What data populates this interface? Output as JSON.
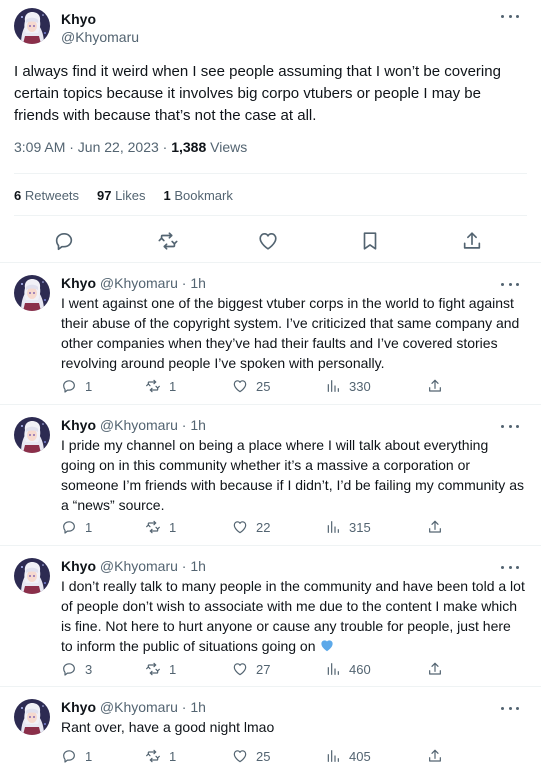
{
  "main_tweet": {
    "author": {
      "name": "Khyo",
      "handle": "@Khyomaru"
    },
    "text": "I always find it weird when I see people assuming that I won’t be covering certain topics because it involves big corpo vtubers or people I may be friends with because that’s not the case at all.",
    "timestamp": "3:09 AM · Jun 22, 2023 · ",
    "views_count": "1,388",
    "views_label": " Views",
    "stats": {
      "retweets_count": "6",
      "retweets_label": " Retweets",
      "likes_count": "97",
      "likes_label": " Likes",
      "bookmarks_count": "1",
      "bookmarks_label": " Bookmark"
    },
    "actions": [
      "reply-icon",
      "retweet-icon",
      "like-icon",
      "bookmark-icon",
      "share-icon"
    ]
  },
  "replies": [
    {
      "name": "Khyo",
      "handle": "@Khyomaru",
      "time": " · 1h",
      "text": "I went against one of the biggest vtuber corps in the world to fight against their abuse of the copyright system. I’ve criticized that same company and other companies when they’ve had their faults and I’ve covered stories revolving around people I’ve spoken with personally.",
      "replies": "1",
      "retweets": "1",
      "likes": "25",
      "views": "330"
    },
    {
      "name": "Khyo",
      "handle": "@Khyomaru",
      "time": " · 1h",
      "text": "I pride my channel on being a place where I will talk about everything going on in this community whether it’s a massive a corporation or someone I’m friends with because if I didn’t, I’d be failing my community as a “news” source.",
      "replies": "1",
      "retweets": "1",
      "likes": "22",
      "views": "315"
    },
    {
      "name": "Khyo",
      "handle": "@Khyomaru",
      "time": " · 1h",
      "text": "I don’t really talk to many people in the community and have been told a lot of people don’t wish to associate with me due to the content I make which is fine. Not here to hurt anyone or cause any trouble for people, just here to inform the public of situations going on",
      "emoji": "blue-heart-emoji",
      "replies": "3",
      "retweets": "1",
      "likes": "27",
      "views": "460"
    },
    {
      "name": "Khyo",
      "handle": "@Khyomaru",
      "time": " · 1h",
      "text": "Rant over, have a good night lmao",
      "replies": "1",
      "retweets": "1",
      "likes": "25",
      "views": "405"
    }
  ],
  "colors": {
    "text": "#0f1419",
    "secondary": "#536471",
    "divider": "#eff3f4",
    "thread_line": "#cfd9de",
    "heart_emoji": "#5da9e9"
  }
}
